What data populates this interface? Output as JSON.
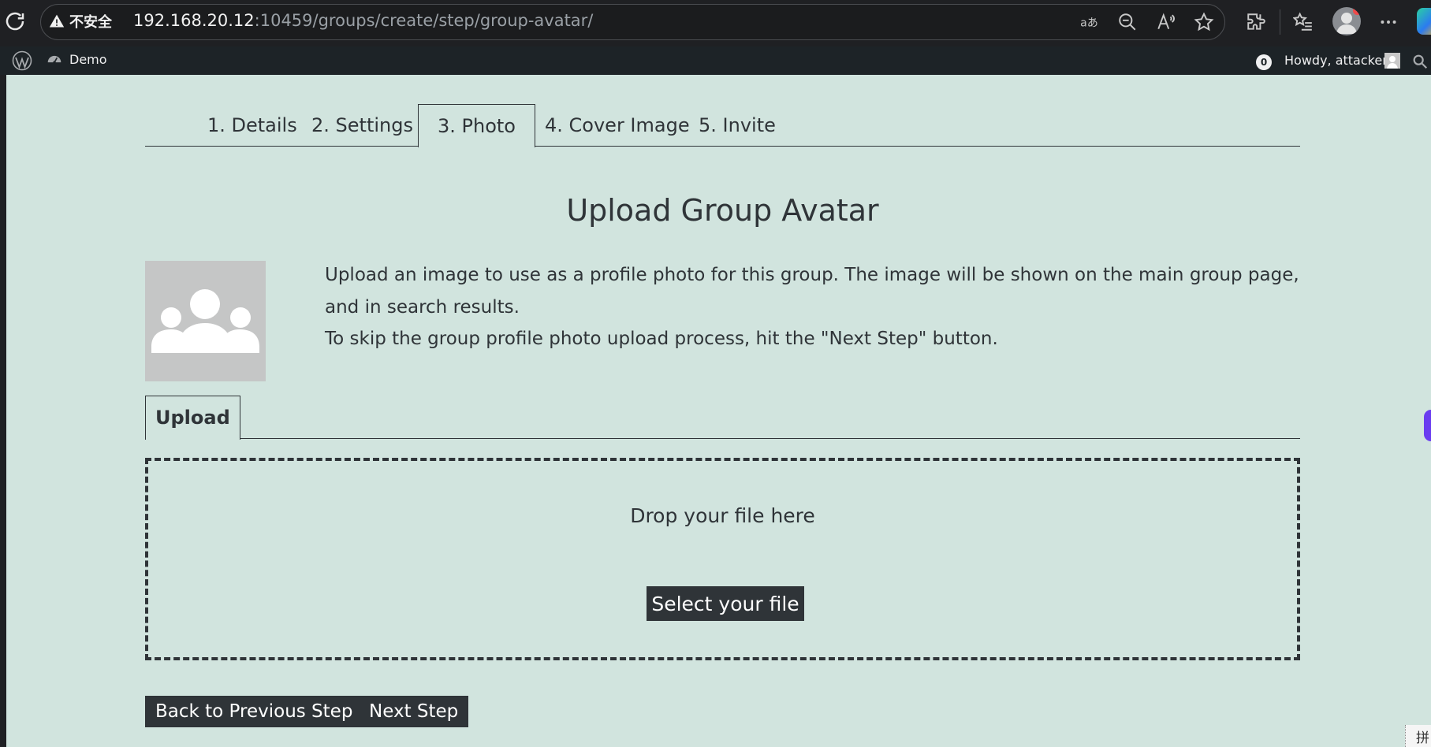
{
  "browser": {
    "insecure_label": "不安全",
    "url_host": "192.168.20.12",
    "url_rest": ":10459/groups/create/step/group-avatar/"
  },
  "wp_admin_bar": {
    "site_name": "Demo",
    "notification_count": "0",
    "howdy": "Howdy, attacker1"
  },
  "steps": [
    {
      "label": "1. Details"
    },
    {
      "label": "2. Settings"
    },
    {
      "label": "3. Photo",
      "active": true
    },
    {
      "label": "4. Cover Image"
    },
    {
      "label": "5. Invite"
    }
  ],
  "main": {
    "title": "Upload Group Avatar",
    "intro_line1": "Upload an image to use as a profile photo for this group. The image will be shown on the main group page, and in search results.",
    "intro_line2": "To skip the group profile photo upload process, hit the \"Next Step\" button.",
    "upload_tab": "Upload",
    "drop_text": "Drop your file here",
    "select_file": "Select your file"
  },
  "actions": {
    "back": "Back to Previous Step",
    "next": "Next Step"
  },
  "ime_indicator": "拼",
  "colors": {
    "page_bg": "#d1e4de",
    "text": "#2f3438",
    "button_bg": "#2f3438",
    "wp_bar": "#1d2327",
    "browser_bar": "#1f2023"
  }
}
